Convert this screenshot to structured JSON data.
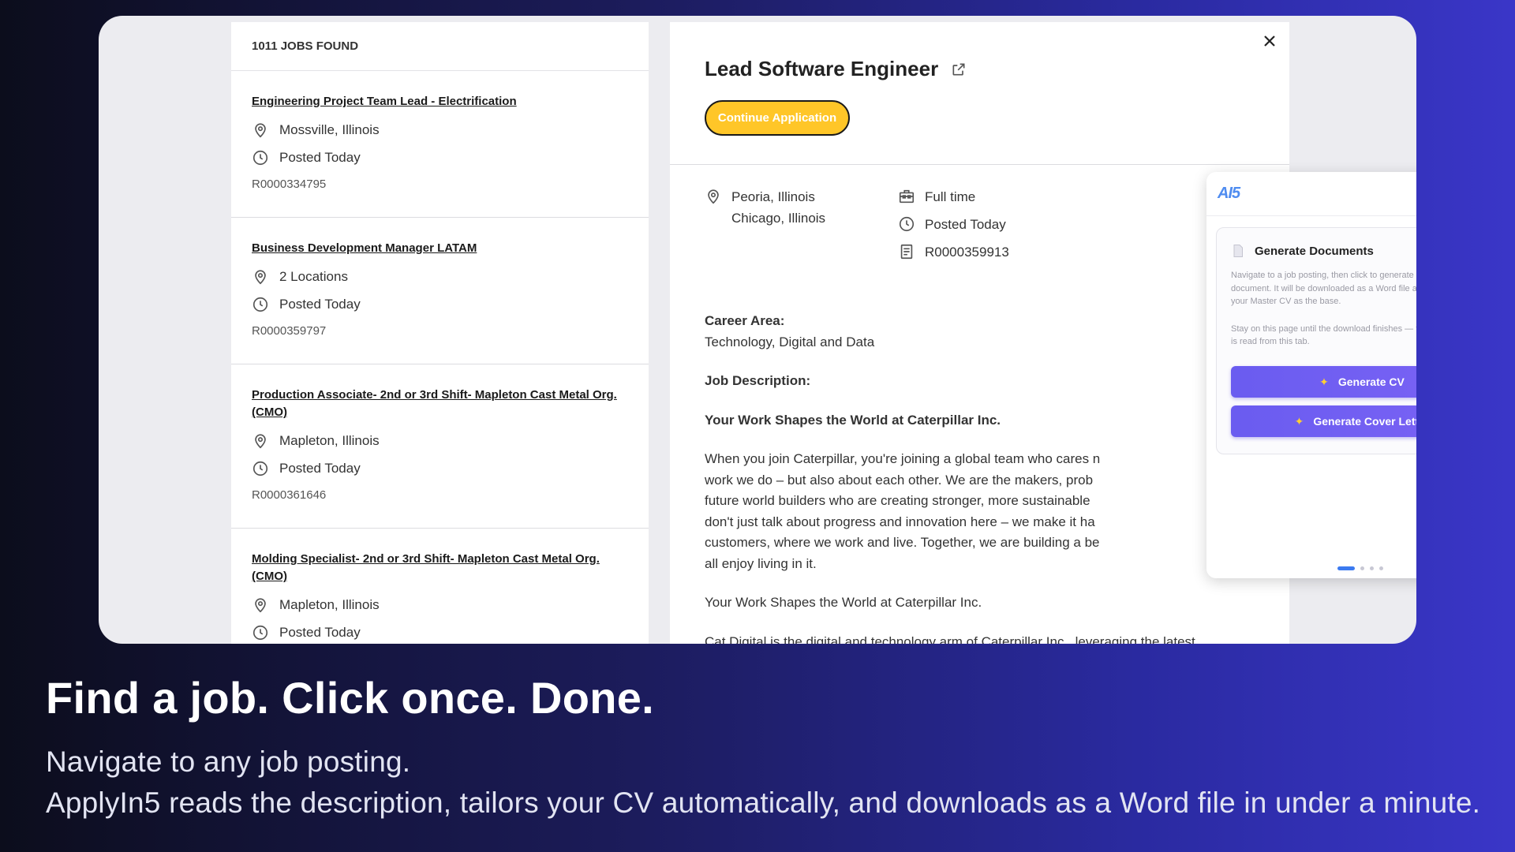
{
  "list": {
    "count_label": "1011 JOBS FOUND",
    "jobs": [
      {
        "title": "Engineering Project Team Lead - Electrification",
        "location": "Mossville, Illinois",
        "posted": "Posted Today",
        "req": "R0000334795"
      },
      {
        "title": "Business Development Manager LATAM",
        "location": "2 Locations",
        "posted": "Posted Today",
        "req": "R0000359797"
      },
      {
        "title": "Production Associate- 2nd or 3rd Shift- Mapleton Cast Metal Org. (CMO)",
        "location": "Mapleton, Illinois",
        "posted": "Posted Today",
        "req": "R0000361646"
      },
      {
        "title": "Molding Specialist- 2nd or 3rd Shift- Mapleton Cast Metal Org. (CMO)",
        "location": "Mapleton, Illinois",
        "posted": "Posted Today",
        "req": ""
      }
    ]
  },
  "detail": {
    "title": "Lead Software Engineer",
    "continue_label": "Continue Application",
    "location_1": "Peoria, Illinois",
    "location_2": "Chicago, Illinois",
    "job_type": "Full time",
    "posted": "Posted Today",
    "req": "R0000359913",
    "career_area_label": "Career Area:",
    "career_area": "Technology, Digital and Data",
    "job_description_label": "Job Description:",
    "headline": "Your Work Shapes the World at Caterpillar Inc.",
    "paragraph_lines": [
      "When you join Caterpillar, you're joining a global team who cares n",
      "work we do – but also about each other.  We are the makers, prob",
      "future world builders who are creating stronger, more sustainable",
      "don't just talk about progress and innovation here – we make it ha",
      "customers, where we work and live. Together, we are building a be",
      "all enjoy living in it."
    ],
    "repeat_line": "Your Work Shapes the World at Caterpillar Inc.",
    "cut_line": "Cat Digital is the digital and technology arm of Caterpillar Inc., leveraging the latest"
  },
  "ai_panel": {
    "logo": "AI5",
    "section_title": "Generate Documents",
    "desc_1": "Navigate to a job posting, then click to generate a tailored document. It will be downloaded as a Word file automatically, using your Master CV as the base.",
    "desc_2": "Stay on this page until the download finishes — the job description is read from this tab.",
    "btn_cv": "Generate CV",
    "btn_cover": "Generate Cover Letter",
    "pager_active": 1,
    "pager_total": 4
  },
  "caption": {
    "headline": "Find a job. Click once. Done.",
    "line_1": "Navigate to any job posting.",
    "line_2": "ApplyIn5 reads the description, tailors your CV automatically, and downloads as a Word file in under a minute."
  },
  "colors": {
    "accent_yellow": "#ffc628",
    "button_purple": "#6a5cf0",
    "logo_blue": "#4f8cf0",
    "pager_active": "#3b7af0"
  }
}
